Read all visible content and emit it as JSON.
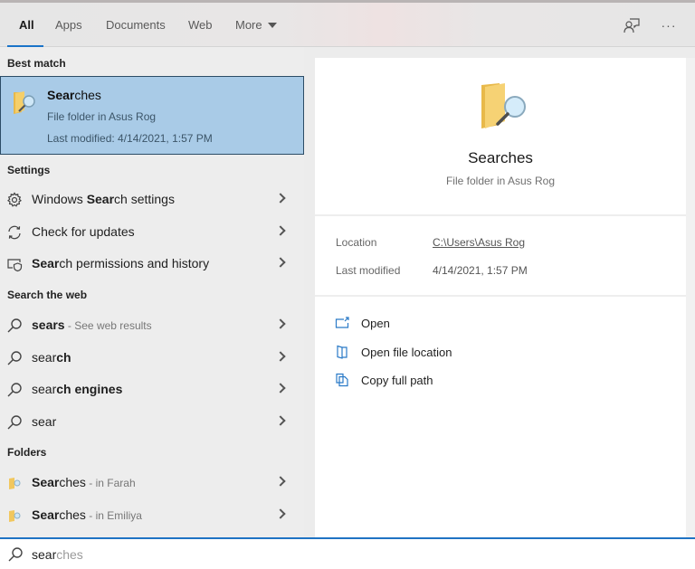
{
  "tabs": [
    {
      "label": "All",
      "active": true
    },
    {
      "label": "Apps"
    },
    {
      "label": "Documents"
    },
    {
      "label": "Web"
    },
    {
      "label": "More"
    }
  ],
  "top_icons": {
    "feedback": "feedback-icon",
    "more": "ellipsis-icon",
    "more_glyph": "···"
  },
  "sections": {
    "best_match": "Best match",
    "settings": "Settings",
    "search_web": "Search the web",
    "folders": "Folders"
  },
  "best_match": {
    "title_bold": "Sear",
    "title_rest": "ches",
    "subtitle": "File folder in Asus Rog",
    "modified": "Last modified: 4/14/2021, 1:57 PM",
    "icon": "search-folder-icon"
  },
  "settings_items": [
    {
      "pre": "Windows ",
      "bold": "Sear",
      "post": "ch settings",
      "icon": "gear-icon"
    },
    {
      "pre": "Check for updates",
      "bold": "",
      "post": "",
      "icon": "refresh-icon"
    },
    {
      "pre": "",
      "bold": "Sear",
      "post": "ch permissions and history",
      "icon": "shield-permissions-icon"
    }
  ],
  "web_items": [
    {
      "pre": "",
      "bold": "sears",
      "post": "",
      "hint": " - See web results"
    },
    {
      "pre": "sear",
      "bold": "ch",
      "post": "",
      "hint": ""
    },
    {
      "pre": "sear",
      "bold": "ch engines",
      "post": "",
      "hint": ""
    },
    {
      "pre": "sear",
      "bold": "",
      "post": "",
      "hint": ""
    }
  ],
  "folder_items": [
    {
      "bold": "Sear",
      "post": "ches",
      "hint": " - in Farah"
    },
    {
      "bold": "Sear",
      "post": "ches",
      "hint": " - in Emiliya"
    }
  ],
  "preview": {
    "title": "Searches",
    "subtitle": "File folder in Asus Rog",
    "location_label": "Location",
    "location_value": "C:\\Users\\Asus Rog",
    "modified_label": "Last modified",
    "modified_value": "4/14/2021, 1:57 PM",
    "actions": [
      {
        "label": "Open",
        "icon": "open-icon"
      },
      {
        "label": "Open file location",
        "icon": "file-location-icon"
      },
      {
        "label": "Copy full path",
        "icon": "copy-path-icon"
      }
    ]
  },
  "search": {
    "typed": "sear",
    "suggestion": "ches"
  },
  "colors": {
    "accent": "#1a73c8",
    "selection_bg": "#a9cbe7",
    "selection_border": "#2c4c66"
  }
}
